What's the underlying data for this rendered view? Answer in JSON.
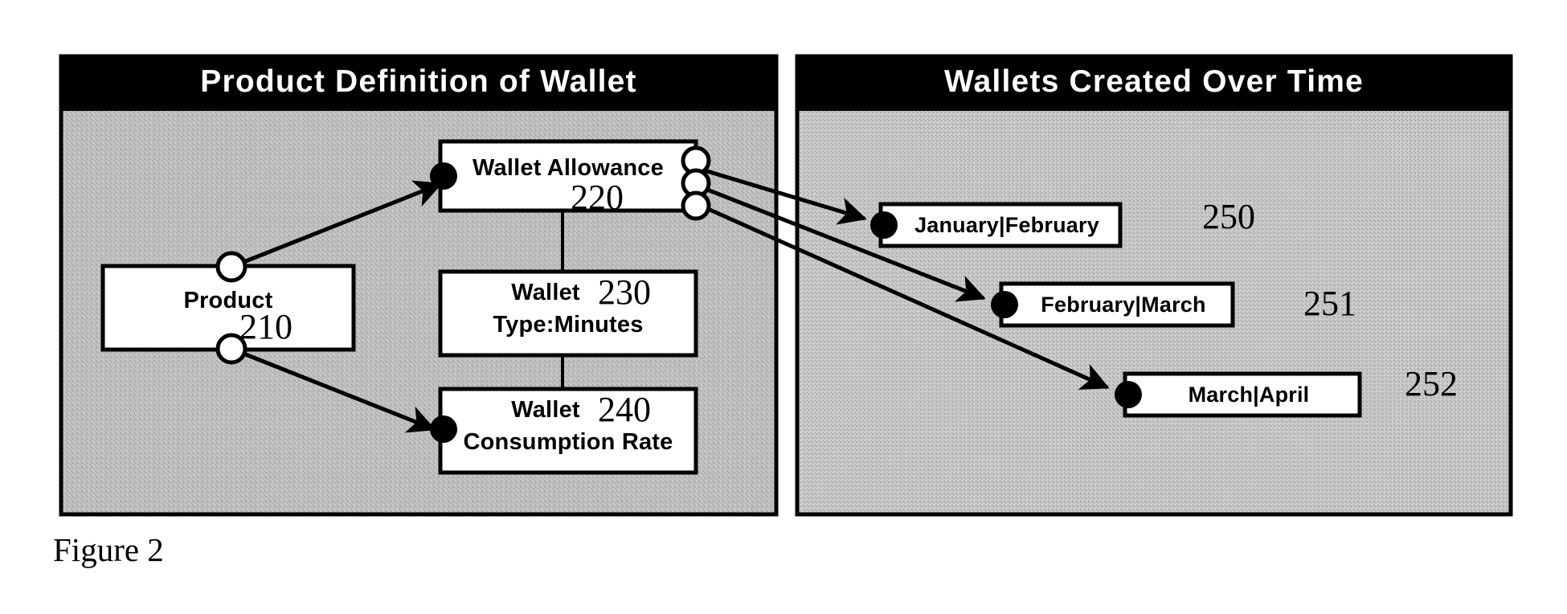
{
  "figure": {
    "caption": "Figure 2"
  },
  "panels": [
    {
      "id": "product-definition",
      "title": "Product Definition of Wallet"
    },
    {
      "id": "wallets-created",
      "title": "Wallets Created Over Time"
    }
  ],
  "left_panel": {
    "title": "Product Definition of Wallet",
    "nodes": [
      {
        "id": "product",
        "label": "Product",
        "ref": "210"
      },
      {
        "id": "wallet-allowance",
        "label": "Wallet Allowance",
        "ref": "220"
      },
      {
        "id": "wallet-type",
        "label_line1": "Wallet",
        "label_line2": "Type:Minutes",
        "ref": "230"
      },
      {
        "id": "wallet-consumption-rate",
        "label_line1": "Wallet",
        "label_line2": "Consumption Rate",
        "ref": "240"
      }
    ]
  },
  "right_panel": {
    "title": "Wallets Created Over Time",
    "nodes": [
      {
        "id": "jan-feb",
        "label": "January|February",
        "ref": "250"
      },
      {
        "id": "feb-mar",
        "label": "February|March",
        "ref": "251"
      },
      {
        "id": "mar-apr",
        "label": "March|April",
        "ref": "252"
      }
    ]
  },
  "colors": {
    "panel_header": "#000000",
    "panel_header_text": "#ffffff",
    "panel_body": "#bdbdbd",
    "node_fill": "#ffffff",
    "stroke": "#000000",
    "page_background": "#ffffff"
  },
  "connections": [
    {
      "from": "product",
      "to": "wallet-allowance",
      "style": "open-circle-to-filled-arrow"
    },
    {
      "from": "product",
      "to": "wallet-consumption-rate",
      "style": "open-circle-to-filled-arrow"
    },
    {
      "from": "wallet-allowance",
      "to": "wallet-type",
      "style": "plain-line"
    },
    {
      "from": "wallet-allowance",
      "to": "jan-feb",
      "style": "open-circle-to-filled-arrow"
    },
    {
      "from": "wallet-allowance",
      "to": "feb-mar",
      "style": "open-circle-to-filled-arrow"
    },
    {
      "from": "wallet-allowance",
      "to": "mar-apr",
      "style": "open-circle-to-filled-arrow"
    }
  ]
}
